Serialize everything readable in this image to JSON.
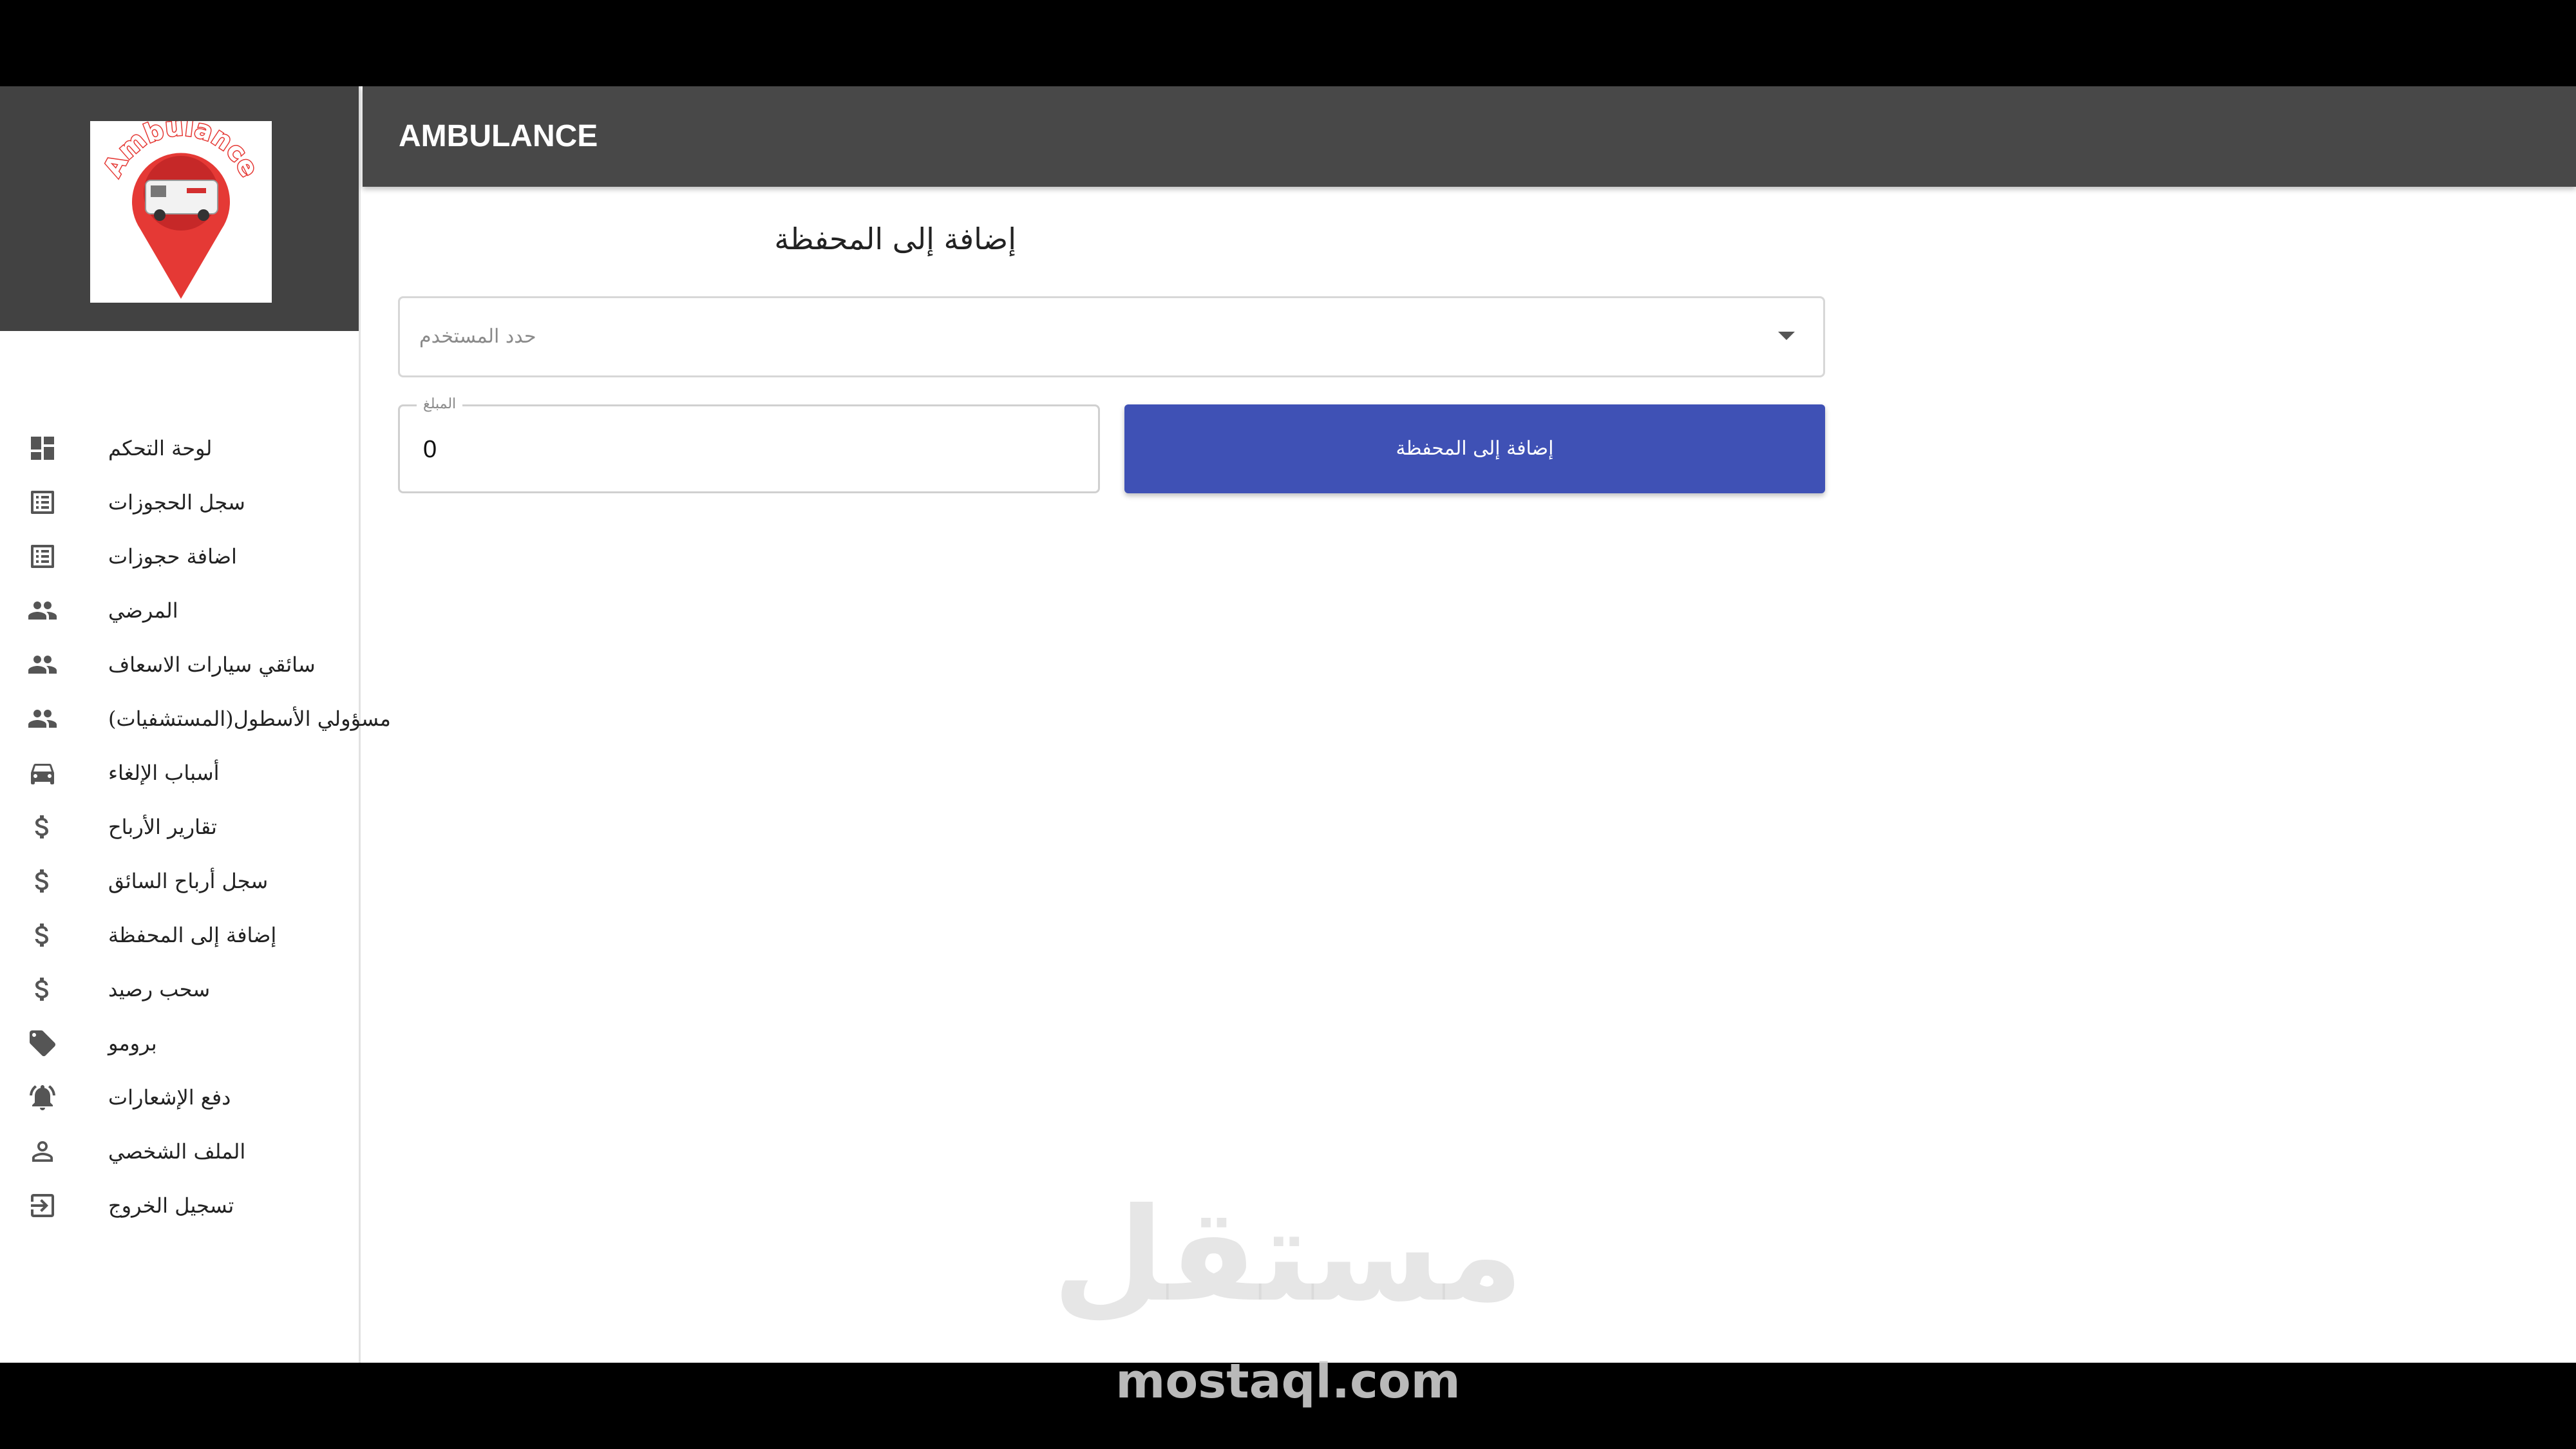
{
  "appbar": {
    "title": "AMBULANCE"
  },
  "logo": {
    "text": "Ambulance"
  },
  "sidebar": {
    "items": [
      {
        "label": "لوحة التحكم",
        "icon": "dashboard-icon"
      },
      {
        "label": "سجل الحجوزات",
        "icon": "list-icon"
      },
      {
        "label": "اضافة حجوزات",
        "icon": "list-icon"
      },
      {
        "label": "المرضي",
        "icon": "people-icon"
      },
      {
        "label": "سائقي سيارات الاسعاف",
        "icon": "people-icon"
      },
      {
        "label": "مسؤولي الأسطول(المستشفيات)",
        "icon": "people-icon"
      },
      {
        "label": "أسباب الإلغاء",
        "icon": "car-icon"
      },
      {
        "label": "تقارير الأرباح",
        "icon": "dollar-icon"
      },
      {
        "label": "سجل أرباح السائق",
        "icon": "dollar-icon"
      },
      {
        "label": "إضافة إلى المحفظة",
        "icon": "dollar-icon"
      },
      {
        "label": "سحب رصيد",
        "icon": "dollar-icon"
      },
      {
        "label": "برومو",
        "icon": "tag-icon"
      },
      {
        "label": "دفع الإشعارات",
        "icon": "bell-icon"
      },
      {
        "label": "الملف الشخصي",
        "icon": "person-icon"
      },
      {
        "label": "تسجيل الخروج",
        "icon": "logout-icon"
      }
    ]
  },
  "main": {
    "title": "إضافة إلى المحفظة",
    "user_select": {
      "placeholder": "حدد المستخدم"
    },
    "amount": {
      "label": "المبلغ",
      "value": "0"
    },
    "submit_label": "إضافة إلى المحفظة"
  },
  "watermark": {
    "arabic": "مستقل",
    "latin": "mostaql.com"
  },
  "colors": {
    "appbar": "#484848",
    "sidebar_header": "#424242",
    "primary": "#3f51b5",
    "logo_red": "#e53935"
  }
}
